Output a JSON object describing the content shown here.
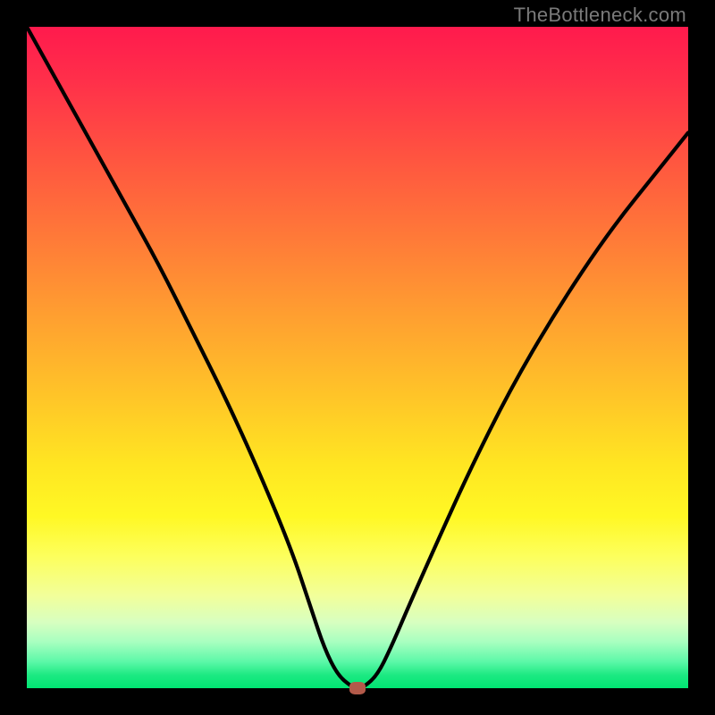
{
  "watermark": "TheBottleneck.com",
  "colors": {
    "frame_bg": "#000000",
    "curve": "#000000",
    "marker": "#b35a4a",
    "gradient_top": "#ff1a4d",
    "gradient_bottom": "#00e573"
  },
  "chart_data": {
    "type": "line",
    "title": "",
    "xlabel": "",
    "ylabel": "",
    "xlim": [
      0,
      100
    ],
    "ylim": [
      0,
      100
    ],
    "series": [
      {
        "name": "bottleneck-curve",
        "x": [
          0,
          5,
          10,
          15,
          20,
          25,
          30,
          35,
          40,
          43,
          45,
          47,
          49,
          50,
          51,
          53,
          55,
          58,
          62,
          67,
          73,
          80,
          88,
          96,
          100
        ],
        "y": [
          100,
          91,
          82,
          73,
          64,
          54,
          44,
          33,
          21,
          12,
          6,
          2,
          0.3,
          0,
          0.2,
          2,
          6,
          13,
          22,
          33,
          45,
          57,
          69,
          79,
          84
        ]
      }
    ],
    "marker": {
      "x": 50,
      "y": 0
    },
    "annotations": []
  }
}
